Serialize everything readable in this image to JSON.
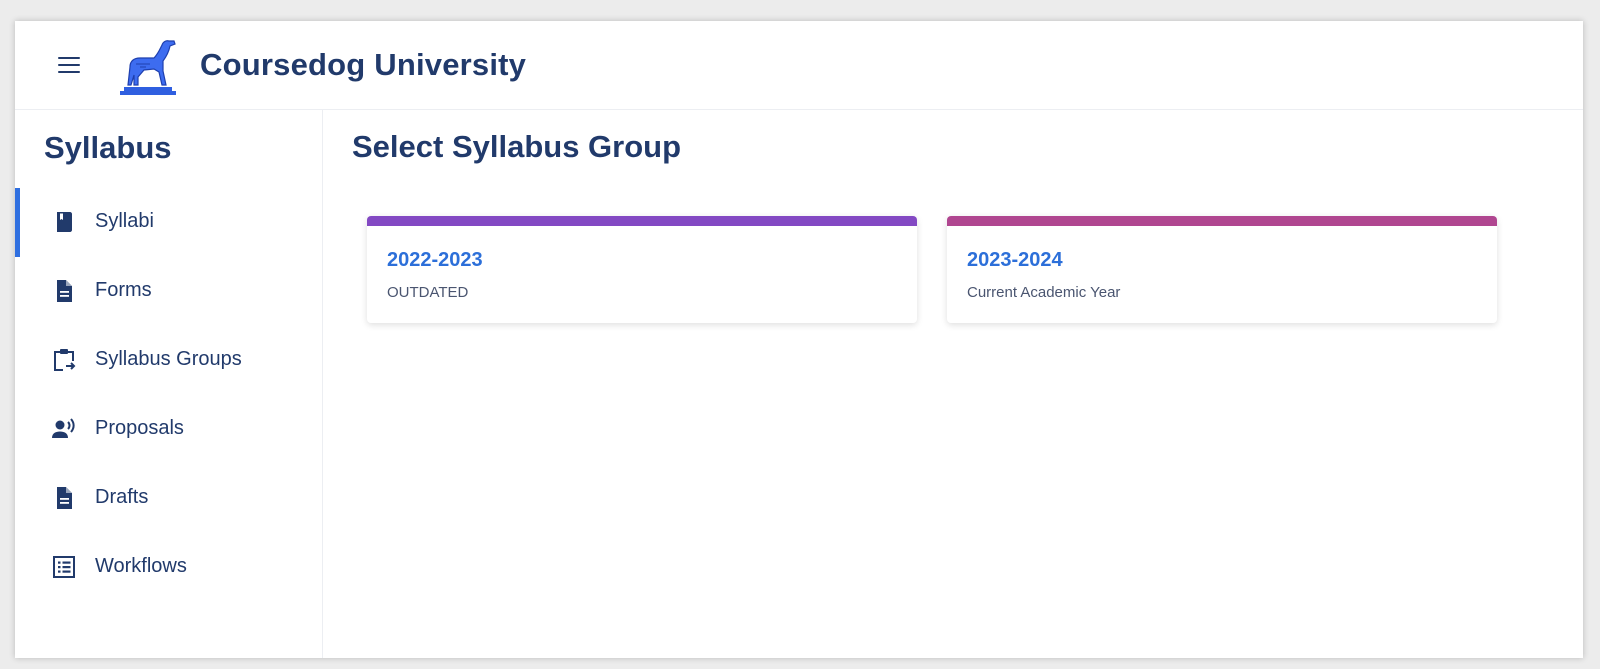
{
  "header": {
    "brand": "Coursedog University",
    "menu_icon": "hamburger-menu-icon",
    "logo_icon": "greyhound-statue-logo"
  },
  "sidebar": {
    "title": "Syllabus",
    "items": [
      {
        "label": "Syllabi",
        "icon": "book-icon",
        "active": true
      },
      {
        "label": "Forms",
        "icon": "document-icon",
        "active": false
      },
      {
        "label": "Syllabus Groups",
        "icon": "clipboard-move-icon",
        "active": false
      },
      {
        "label": "Proposals",
        "icon": "person-voice-icon",
        "active": false
      },
      {
        "label": "Drafts",
        "icon": "document-icon",
        "active": false
      },
      {
        "label": "Workflows",
        "icon": "list-icon",
        "active": false
      }
    ]
  },
  "main": {
    "title": "Select Syllabus Group",
    "groups": [
      {
        "title": "2022-2023",
        "subtitle": "OUTDATED",
        "color": "#8349c3"
      },
      {
        "title": "2023-2024",
        "subtitle": "Current Academic Year",
        "color": "#b04690"
      }
    ]
  },
  "colors": {
    "primary_text": "#213a6b",
    "link": "#2c6fd9",
    "active_indicator": "#2f6fe0"
  }
}
